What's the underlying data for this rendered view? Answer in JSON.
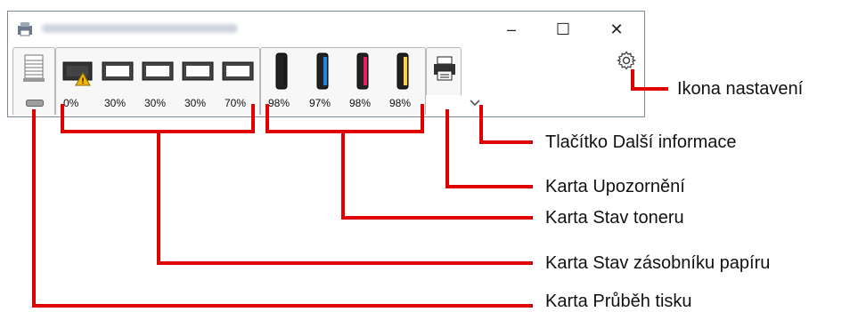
{
  "window": {
    "buttons": {
      "minimize": "–",
      "maximize": "☐",
      "close": "✕"
    }
  },
  "paper_tray_levels": [
    "0%",
    "30%",
    "30%",
    "30%",
    "70%"
  ],
  "toner_levels": [
    "98%",
    "97%",
    "98%",
    "98%"
  ],
  "toner_colors": [
    "#1a1a1a",
    "#1e88e5",
    "#e91e63",
    "#fdd835"
  ],
  "icons": {
    "settings": "gear-icon",
    "more_info": "chevron-down-icon",
    "print_progress": "paper-stack-icon",
    "alert_tab": "printer-icon",
    "warning": "warning-icon"
  },
  "callouts": {
    "settings_icon": "Ikona nastavení",
    "more_info_button": "Tlačítko Další informace",
    "alert_tab": "Karta Upozornění",
    "toner_tab": "Karta Stav toneru",
    "paper_tab": "Karta Stav zásobníku papíru",
    "print_progress_tab": "Karta Průběh tisku"
  },
  "accent_color": "#e00000"
}
